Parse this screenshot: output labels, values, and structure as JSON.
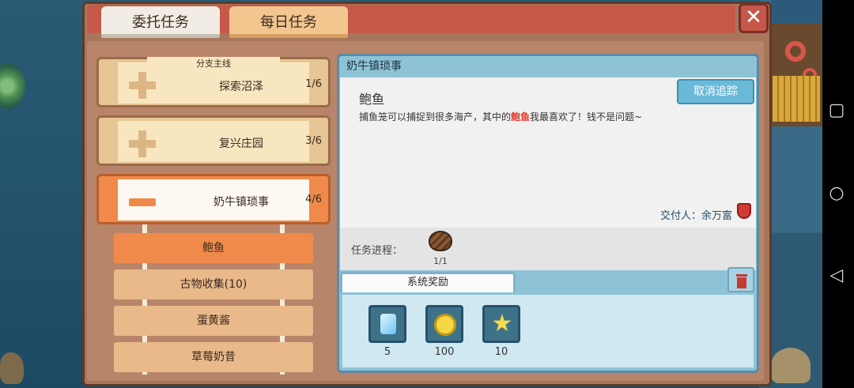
{
  "tabs": {
    "commission": "委托任务",
    "daily": "每日任务"
  },
  "close_icon": "close-x-icon",
  "quest_list": {
    "branch_label": "分支主线",
    "quests": [
      {
        "name": "探索沼泽",
        "progress": "1/6"
      },
      {
        "name": "复兴庄园",
        "progress": "3/6"
      },
      {
        "name": "奶牛镇琐事",
        "progress": "4/6"
      }
    ],
    "subquests": [
      "鲍鱼",
      "古物收集(10)",
      "蛋黄酱",
      "草莓奶昔"
    ]
  },
  "detail": {
    "header": "奶牛镇琐事",
    "title": "鲍鱼",
    "desc_before": "捕鱼笼可以捕捉到很多海产，其中的",
    "desc_highlight": "鲍鱼",
    "desc_after": "我最喜欢了！钱不是问题~",
    "cancel_label": "取消追踪",
    "deliverer": "交付人：余万富",
    "progress_label": "任务进程：",
    "progress_value": "1/1",
    "reward_tab": "系统奖励",
    "rewards": [
      {
        "icon": "gem-icon",
        "value": "5"
      },
      {
        "icon": "gold-coin-icon",
        "value": "100"
      },
      {
        "icon": "star-icon",
        "value": "10"
      }
    ]
  },
  "colors": {
    "accent_orange": "#f08a4b",
    "header_red": "#c6584a",
    "panel_blue": "#8ec3d6",
    "highlight_red": "#e0392b"
  }
}
